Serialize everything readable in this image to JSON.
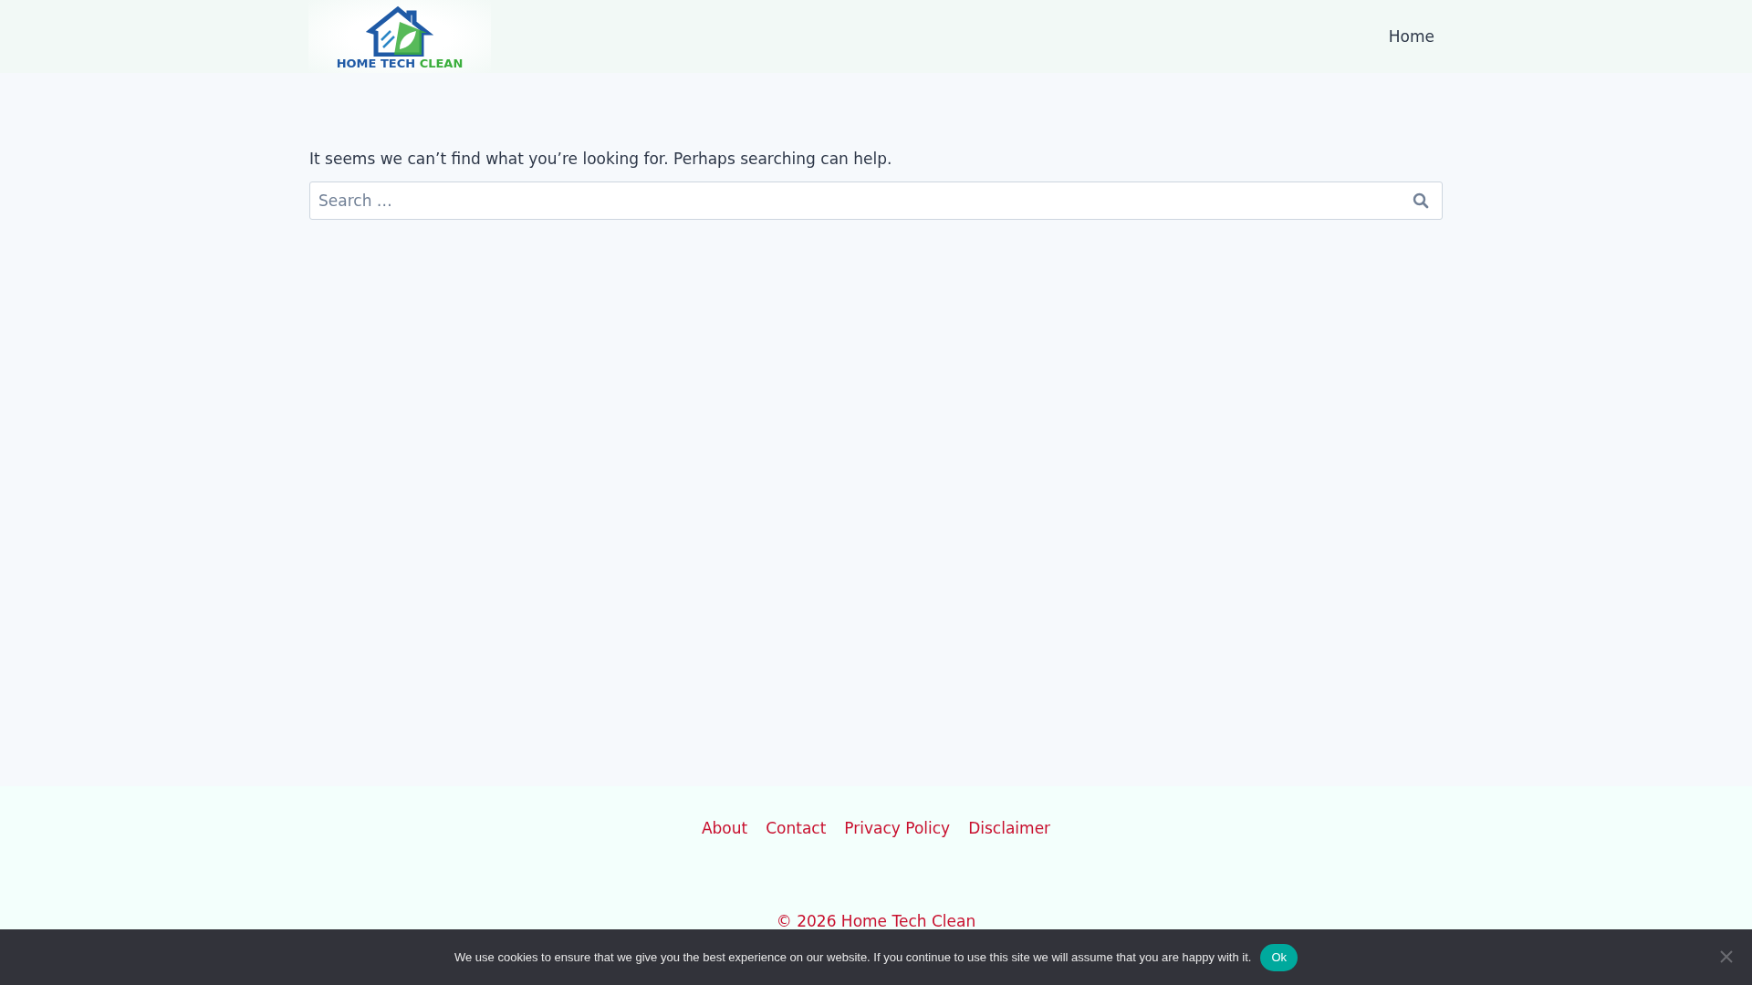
{
  "header": {
    "logo": {
      "words": [
        {
          "text": "HOME TECH",
          "color": "#1f5aa6"
        },
        {
          "text": "CLEAN",
          "color": "#3aae3c"
        }
      ]
    },
    "nav": [
      {
        "label": "Home"
      }
    ]
  },
  "content": {
    "message": "It seems we can’t find what you’re looking for. Perhaps searching can help.",
    "search": {
      "placeholder": "Search …"
    }
  },
  "footer": {
    "links": [
      {
        "label": "About"
      },
      {
        "label": "Contact"
      },
      {
        "label": "Privacy Policy"
      },
      {
        "label": "Disclaimer"
      }
    ],
    "copyright": "© 2026 Home Tech Clean"
  },
  "cookie_notice": {
    "text": "We use cookies to ensure that we give you the best experience on our website. If you continue to use this site we will assume that you are happy with it.",
    "button": "Ok"
  }
}
